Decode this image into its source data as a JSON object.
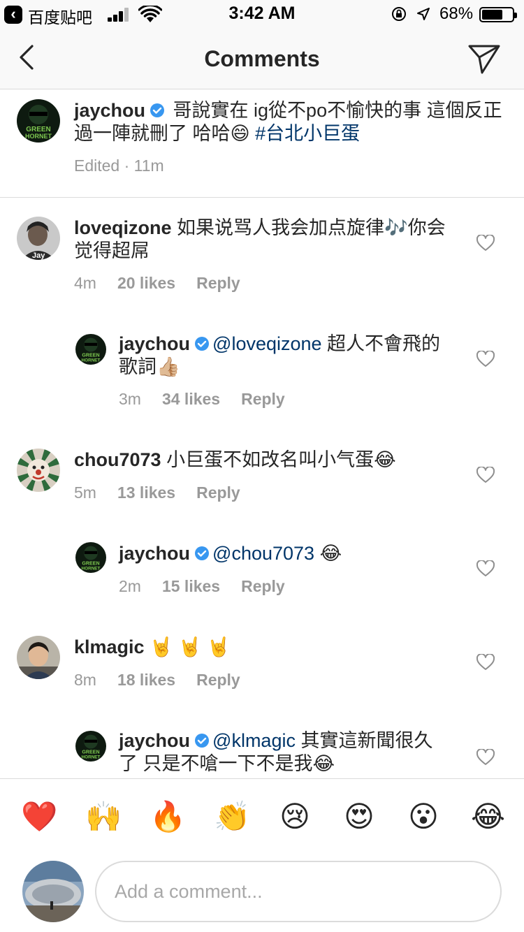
{
  "status_bar": {
    "carrier": "百度贴吧",
    "time": "3:42 AM",
    "battery_pct": "68%",
    "battery_level": 0.68
  },
  "nav": {
    "title": "Comments"
  },
  "caption": {
    "username": "jaychou",
    "verified": true,
    "text": " 哥說實在 ig從不po不愉快的事 這個反正過一陣就刪了 哈哈😄 ",
    "hashtag": "#台北小巨蛋",
    "edited": "Edited · 11m"
  },
  "comments": [
    {
      "username": "loveqizone",
      "text": " 如果说骂人我会加点旋律🎶你会觉得超屌",
      "time": "4m",
      "likes": "20 likes",
      "reply_label": "Reply",
      "avatar_icon": "user-avatar-jay-icon"
    },
    {
      "username": "jaychou",
      "verified": true,
      "mention": "@loveqizone",
      "text": " 超人不會飛的歌詞👍🏼",
      "time": "3m",
      "likes": "34 likes",
      "reply_label": "Reply",
      "is_reply": true
    },
    {
      "username": "chou7073",
      "text": " 小巨蛋不如改名叫小气蛋😂",
      "time": "5m",
      "likes": "13 likes",
      "reply_label": "Reply",
      "avatar_icon": "user-avatar-clown-icon"
    },
    {
      "username": "jaychou",
      "verified": true,
      "mention": "@chou7073",
      "text": " 😂",
      "time": "2m",
      "likes": "15 likes",
      "reply_label": "Reply",
      "is_reply": true
    },
    {
      "username": "klmagic",
      "text": " 🤘 🤘 🤘",
      "time": "8m",
      "likes": "18 likes",
      "reply_label": "Reply",
      "avatar_icon": "user-avatar-photo-icon"
    },
    {
      "username": "jaychou",
      "verified": true,
      "mention": "@klmagic",
      "text": " 其實這新聞很久了 只是不嗆一下不是我😂",
      "is_reply": true
    }
  ],
  "emoji_bar": [
    "❤️",
    "🙌",
    "🔥",
    "👏",
    "😢",
    "😍",
    "😮",
    "😂"
  ],
  "composer": {
    "placeholder": "Add a comment..."
  },
  "colors": {
    "link": "#003569",
    "meta": "#999999",
    "verified": "#3897f0",
    "divider": "#dbdbdb"
  }
}
